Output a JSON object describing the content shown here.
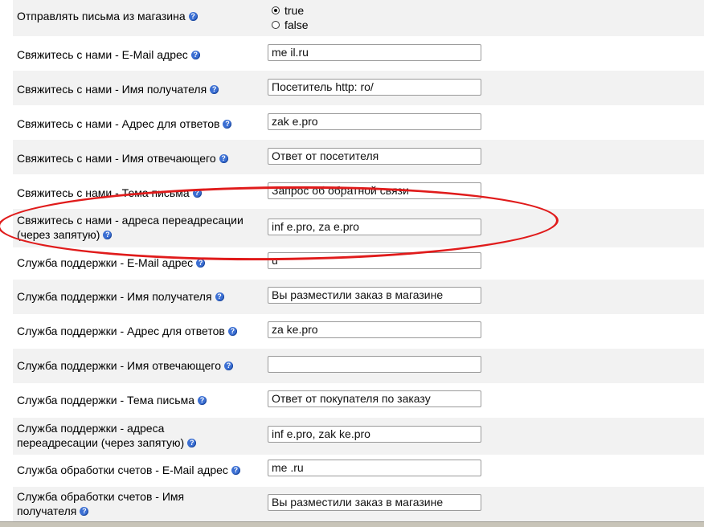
{
  "send_emails": {
    "label": "Отправлять письма из магазина",
    "options": [
      "true",
      "false"
    ],
    "selected": "true"
  },
  "rows": [
    {
      "label": "Свяжитесь с нами - E-Mail адрес",
      "value": "me           il.ru"
    },
    {
      "label": "Свяжитесь с нами - Имя получателя",
      "value": "Посетитель http:            ro/"
    },
    {
      "label": "Свяжитесь с нами - Адрес для ответов",
      "value": "zak            e.pro"
    },
    {
      "label": "Свяжитесь с нами - Имя отвечающего",
      "value": "Ответ от посетителя"
    },
    {
      "label": "Свяжитесь с нами - Тема письма",
      "value": "Запрос об обратной связи"
    },
    {
      "label": "Свяжитесь с нами - адреса переадресации (через запятую)",
      "value": "inf         e.pro, za            e.pro"
    },
    {
      "label": "Служба поддержки - E-Mail адрес",
      "value": "               u"
    },
    {
      "label": "Служба поддержки - Имя получателя",
      "value": "Вы разместили заказ в магазине"
    },
    {
      "label": "Служба поддержки - Адрес для ответов",
      "value": "za           ke.pro"
    },
    {
      "label": "Служба поддержки - Имя отвечающего",
      "value": ""
    },
    {
      "label": "Служба поддержки - Тема письма",
      "value": "Ответ от покупателя по заказу"
    },
    {
      "label": "Служба поддержки - адреса переадресации (через запятую)",
      "value": "inf         e.pro, zak           ke.pro"
    },
    {
      "label": "Служба обработки счетов - E-Mail адрес",
      "value": "me            .ru"
    },
    {
      "label": "Служба обработки счетов - Имя получателя",
      "value": "Вы разместили заказ в магазине"
    }
  ],
  "help_icon": "?",
  "highlight_color": "#e01b1b"
}
